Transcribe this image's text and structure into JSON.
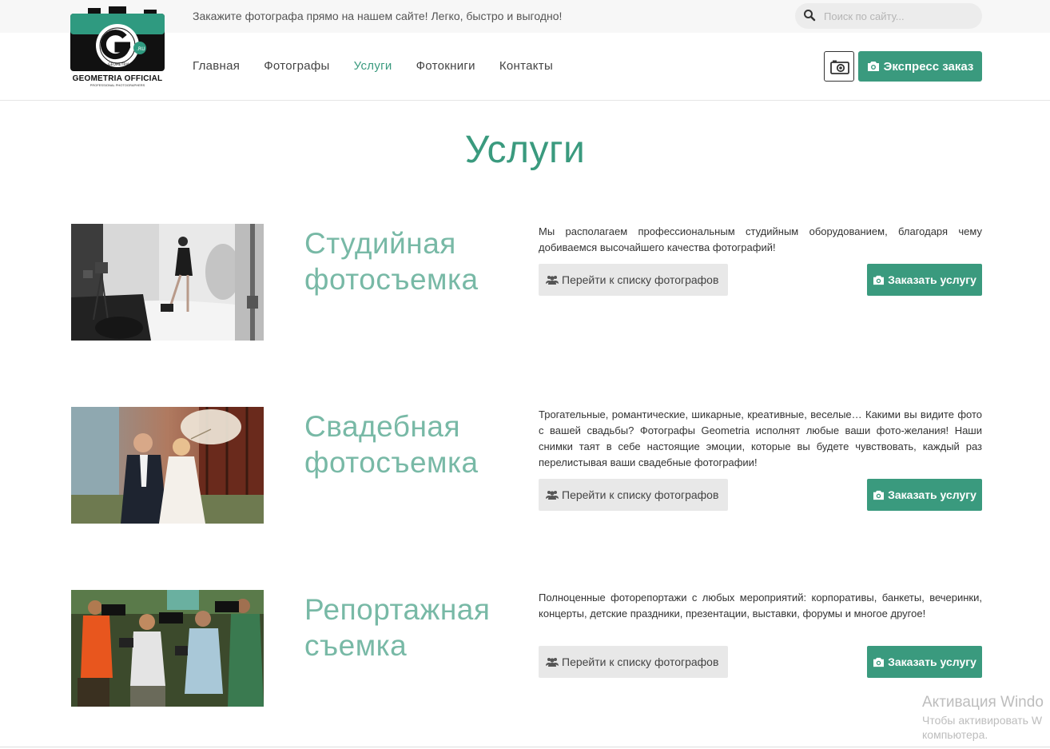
{
  "topbar": {
    "tagline": "Закажите фотографа прямо на нашем сайте! Легко, быстро и выгодно!",
    "search_placeholder": "Поиск по сайту..."
  },
  "logo": {
    "text": "GEOMETRIA OFFICIAL",
    "sub": "PROFESSIONAL PHOTOGRAPHERS"
  },
  "nav": {
    "items": [
      {
        "label": "Главная"
      },
      {
        "label": "Фотографы"
      },
      {
        "label": "Услуги",
        "active": true
      },
      {
        "label": "Фотокниги"
      },
      {
        "label": "Контакты"
      }
    ]
  },
  "header": {
    "express_label": "Экспресс заказ"
  },
  "page": {
    "title": "Услуги"
  },
  "services": [
    {
      "title_line1": "Студийная",
      "title_line2": "фотосъемка",
      "description": "Мы располагаем профессиональным студийным оборудованием, благодаря чему добиваемся высочайшего качества фотографий!",
      "list_button": "Перейти к списку фотографов",
      "order_button": "Заказать услугу"
    },
    {
      "title_line1": "Свадебная",
      "title_line2": "фотосъемка",
      "description": "Трогательные, романтические, шикарные, креативные, веселые… Какими вы видите фото с вашей свадьбы? Фотографы Geometria исполнят любые ваши фото-желания! Наши снимки таят в себе настоящие эмоции, которые вы будете чувствовать, каждый раз перелистывая ваши свадебные фотографии!",
      "list_button": "Перейти к списку фотографов",
      "order_button": "Заказать услугу"
    },
    {
      "title_line1": "Репортажная",
      "title_line2": "съемка",
      "description": "Полноценные фоторепортажи с любых мероприятий: корпоративы, банкеты, вечеринки, концерты, детские праздники, презентации, выставки, форумы и многое другое!",
      "list_button": "Перейти к списку фотографов",
      "order_button": "Заказать услугу"
    }
  ],
  "watermark": {
    "line1": "Активация Windo",
    "line2": "Чтобы активировать W",
    "line3": "компьютера."
  },
  "colors": {
    "accent": "#3a9a7e",
    "title_light": "#78b9a6"
  }
}
